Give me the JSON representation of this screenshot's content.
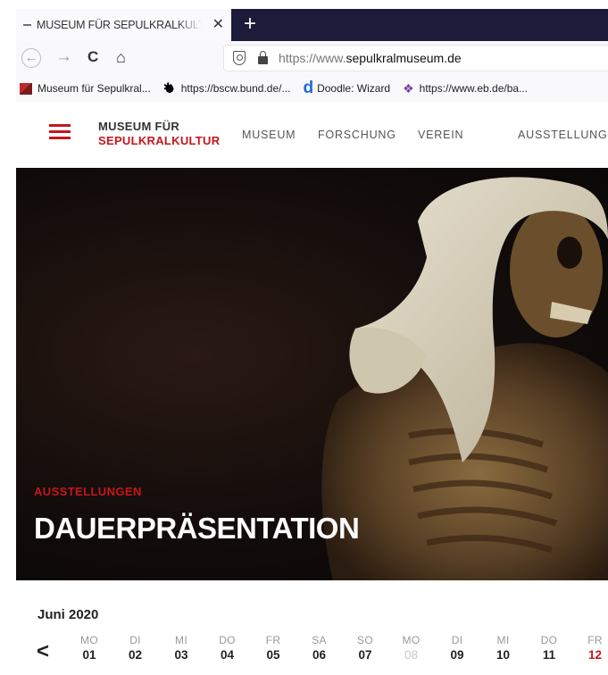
{
  "browser": {
    "tab_title": "MUSEUM FÜR SEPULKRALKULTUR",
    "tab_close_glyph": "✕",
    "new_tab_glyph": "+",
    "url_prefix": "https://www.",
    "url_domain": "sepulkralmuseum.de",
    "bookmarks": [
      {
        "label": "Museum für Sepulkral...",
        "icon": "museum-favicon"
      },
      {
        "label": "https://bscw.bund.de/...",
        "icon": "federal-eagle-icon"
      },
      {
        "label": "Doodle: Wizard",
        "icon": "doodle-icon"
      },
      {
        "label": "https://www.eb.de/ba...",
        "icon": "eb-icon"
      }
    ]
  },
  "site": {
    "logo_line1": "MUSEUM FÜR",
    "logo_line2": "SEPULKRALKULTUR",
    "nav": [
      "MUSEUM",
      "FORSCHUNG",
      "VEREIN",
      "AUSSTELLUNGEN"
    ],
    "accent_color": "#c4161c"
  },
  "hero": {
    "kicker": "AUSSTELLUNGEN",
    "title": "DAUERPRÄSENTATION"
  },
  "calendar": {
    "month": "Juni 2020",
    "prev_glyph": "<",
    "days": [
      {
        "dow": "MO",
        "num": "01"
      },
      {
        "dow": "DI",
        "num": "02"
      },
      {
        "dow": "MI",
        "num": "03"
      },
      {
        "dow": "DO",
        "num": "04"
      },
      {
        "dow": "FR",
        "num": "05"
      },
      {
        "dow": "SA",
        "num": "06"
      },
      {
        "dow": "SO",
        "num": "07"
      },
      {
        "dow": "MO",
        "num": "08",
        "muted": true
      },
      {
        "dow": "DI",
        "num": "09"
      },
      {
        "dow": "MI",
        "num": "10"
      },
      {
        "dow": "DO",
        "num": "11"
      },
      {
        "dow": "FR",
        "num": "12",
        "today": true
      }
    ]
  }
}
